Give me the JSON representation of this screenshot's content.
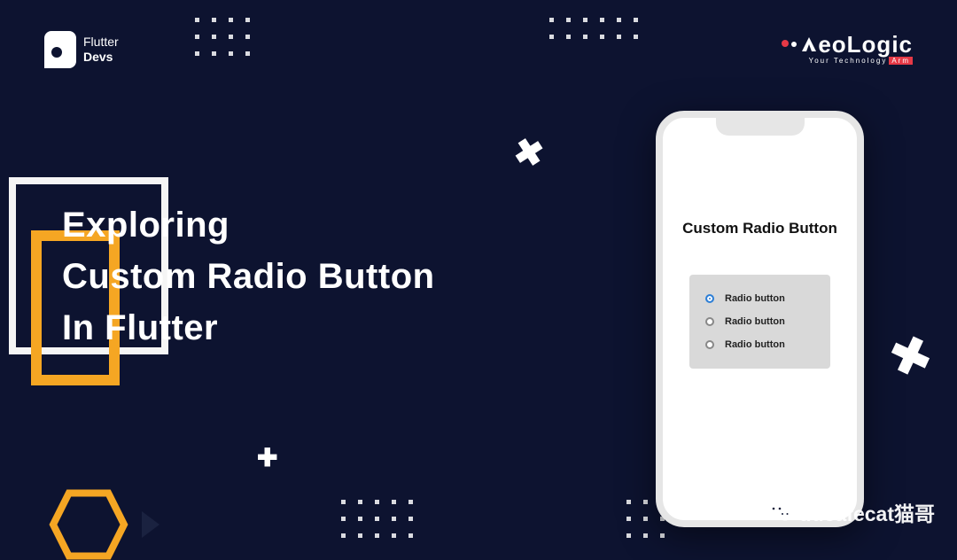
{
  "logoLeft": {
    "line1": "Flutter",
    "line2": "Devs"
  },
  "logoRight": {
    "brand": "eoLogic",
    "tagline": "Your Technology",
    "badge": "Arm"
  },
  "title": {
    "line1": "Exploring",
    "line2": "Custom Radio Button",
    "line3": "In Flutter"
  },
  "phone": {
    "heading": "Custom Radio Button",
    "options": [
      {
        "label": "Radio button",
        "selected": true
      },
      {
        "label": "Radio button",
        "selected": false
      },
      {
        "label": "Radio button",
        "selected": false
      }
    ]
  },
  "watermark": "ducafecat猫哥"
}
